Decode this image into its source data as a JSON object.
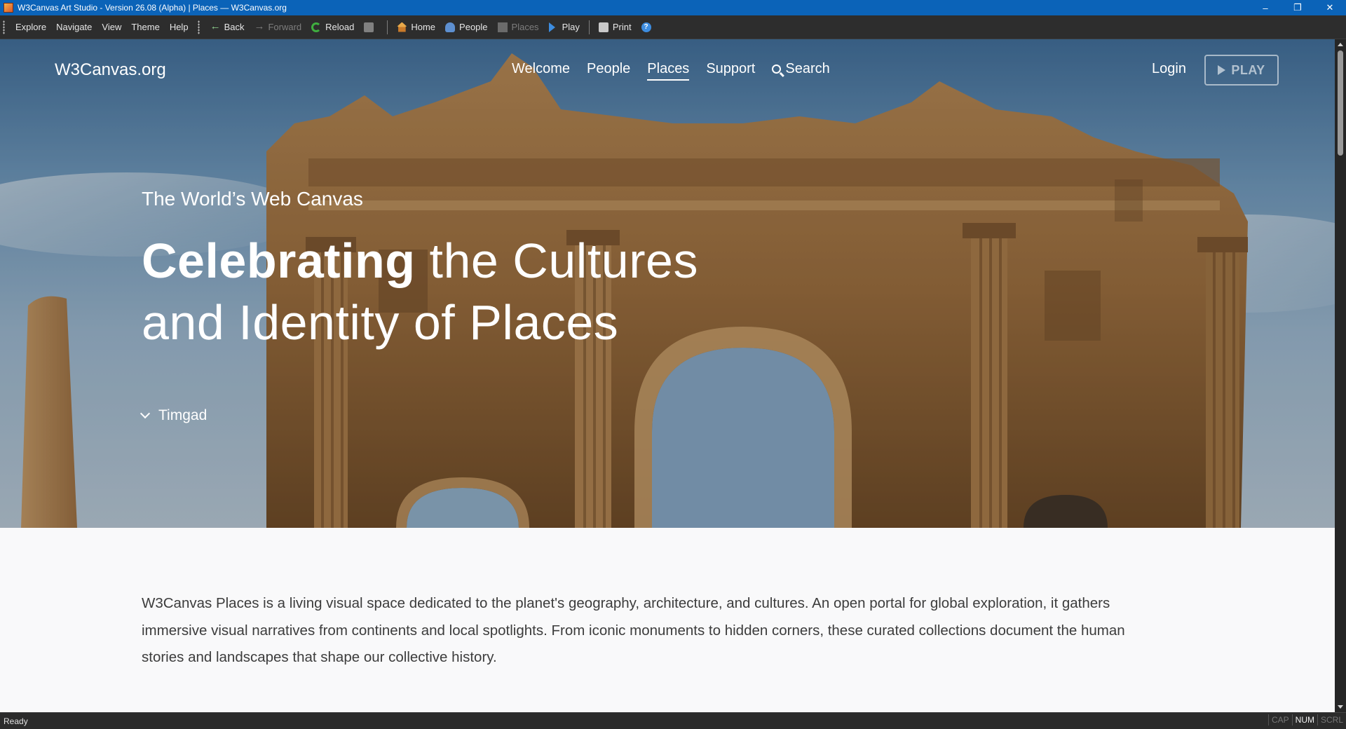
{
  "window": {
    "title": "W3Canvas Art Studio - Version 26.08 (Alpha)  |  Places — W3Canvas.org",
    "controls": [
      "–",
      "❐",
      "✕"
    ]
  },
  "menu": [
    "Explore",
    "Navigate",
    "View",
    "Theme",
    "Help"
  ],
  "toolbar": {
    "back": "Back",
    "forward": "Forward",
    "reload": "Reload",
    "home": "Home",
    "people": "People",
    "places": "Places",
    "play": "Play",
    "print": "Print"
  },
  "site": {
    "logo": "W3Canvas.org",
    "nav": [
      "Welcome",
      "People",
      "Places",
      "Support",
      "Search"
    ],
    "active_nav": "Places",
    "login": "Login",
    "play_button": "PLAY"
  },
  "hero": {
    "eyebrow": "The World’s Web Canvas",
    "headline_bold": "Celebrating",
    "headline_rest_1": " the Cultures",
    "headline_line_2": "and Identity of Places",
    "caption": "Timgad",
    "image_subject": "Arch of Trajan at Timgad"
  },
  "intro": {
    "text": "W3Canvas Places is a living visual space dedicated to the planet's geography, architecture, and cultures. An open portal for global exploration, it gathers immersive visual narratives from continents and local spotlights. From iconic monuments to hidden corners, these curated collections document the human stories and landscapes that shape our collective history."
  },
  "statusbar": {
    "text": "Ready",
    "indicators": [
      "CAP",
      "NUM",
      "SCRL"
    ],
    "active_indicator": "NUM"
  },
  "colors": {
    "titlebar": "#0b63b8",
    "toolbar": "#2d2d2d",
    "stone": "#a87a49",
    "sky": "#6f9ac0"
  }
}
